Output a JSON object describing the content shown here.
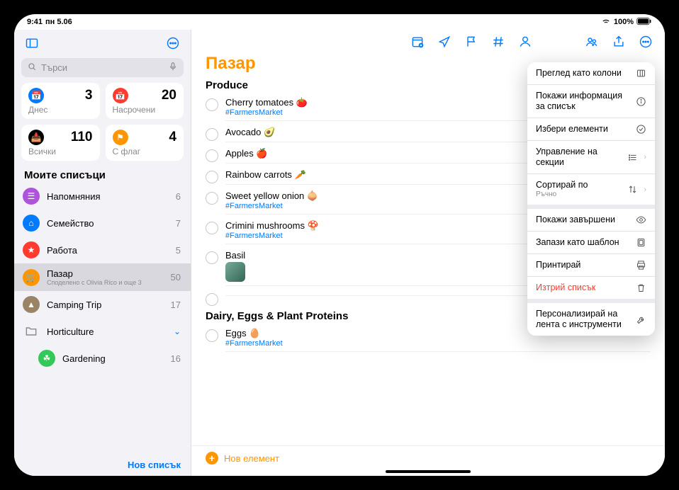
{
  "status": {
    "time": "9:41",
    "date": "пн 5.06",
    "battery": "100%"
  },
  "search": {
    "placeholder": "Търси"
  },
  "smart": [
    {
      "label": "Днес",
      "count": 3,
      "color": "#007aff",
      "glyph": "📅"
    },
    {
      "label": "Насрочени",
      "count": 20,
      "color": "#ff3b30",
      "glyph": "📅"
    },
    {
      "label": "Всички",
      "count": 110,
      "color": "#000000",
      "glyph": "📥"
    },
    {
      "label": "С флаг",
      "count": 4,
      "color": "#ff9500",
      "glyph": "⚑"
    }
  ],
  "myListsHeader": "Моите списъци",
  "lists": [
    {
      "name": "Напомняния",
      "count": 6,
      "color": "#af52de",
      "glyph": "☰"
    },
    {
      "name": "Семейство",
      "count": 7,
      "color": "#007aff",
      "glyph": "⌂"
    },
    {
      "name": "Работа",
      "count": 5,
      "color": "#ff3b30",
      "glyph": "★"
    },
    {
      "name": "Пазар",
      "sub": "Споделено с Olivia Rico и още 3",
      "count": 50,
      "color": "#ff9500",
      "glyph": "🛒",
      "selected": true
    },
    {
      "name": "Camping Trip",
      "count": 17,
      "color": "#9a8466",
      "glyph": "▲"
    },
    {
      "name": "Horticulture",
      "folder": true,
      "expanded": true
    },
    {
      "name": "Gardening",
      "count": 16,
      "color": "#34c759",
      "glyph": "☘",
      "child": true
    }
  ],
  "newListLabel": "Нов списък",
  "listTitle": "Пазар",
  "groups": [
    {
      "name": "Produce",
      "items": [
        {
          "title": "Cherry tomatoes 🍅",
          "tag": "#FarmersMarket"
        },
        {
          "title": "Avocado 🥑"
        },
        {
          "title": "Apples 🍎"
        },
        {
          "title": "Rainbow carrots 🥕"
        },
        {
          "title": "Sweet yellow onion 🧅",
          "tag": "#FarmersMarket"
        },
        {
          "title": "Crimini mushrooms 🍄",
          "tag": "#FarmersMarket"
        },
        {
          "title": "Basil",
          "thumb": true
        },
        {
          "title": "",
          "empty": true
        }
      ]
    },
    {
      "name": "Dairy, Eggs & Plant Proteins",
      "collapsible": true,
      "items": [
        {
          "title": "Eggs 🥚",
          "tag": "#FarmersMarket"
        }
      ]
    }
  ],
  "newItemLabel": "Нов елемент",
  "menu": [
    {
      "label": "Преглед като колони",
      "icon": "columns"
    },
    {
      "label": "Покажи информация за списък",
      "icon": "info"
    },
    {
      "label": "Избери елементи",
      "icon": "select"
    },
    {
      "label": "Управление на секции",
      "icon": "sections",
      "chevron": true
    },
    {
      "label": "Сортирай по",
      "sub": "Ръчно",
      "icon": "sort",
      "chevron": true,
      "sepAfter": true
    },
    {
      "label": "Покажи завършени",
      "icon": "eye"
    },
    {
      "label": "Запази като шаблон",
      "icon": "template"
    },
    {
      "label": "Принтирай",
      "icon": "print"
    },
    {
      "label": "Изтрий списък",
      "icon": "trash",
      "destructive": true,
      "sepAfter": true
    },
    {
      "label": "Персонализирай на лента с инструменти",
      "icon": "wrench"
    }
  ]
}
